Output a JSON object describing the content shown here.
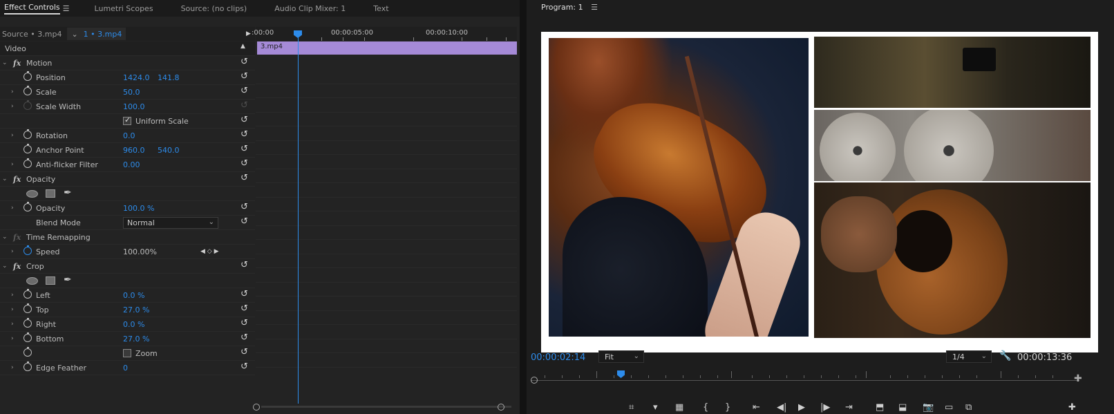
{
  "tabs": [
    "Effect Controls",
    "Lumetri Scopes",
    "Source: (no clips)",
    "Audio Clip Mixer: 1",
    "Text"
  ],
  "effect_controls": {
    "source_label": "Source • 3.mp4",
    "clip_label": "1 • 3.mp4",
    "video_label": "Video",
    "motion": {
      "label": "Motion",
      "position": {
        "label": "Position",
        "x": "1424.0",
        "y": "141.8"
      },
      "scale": {
        "label": "Scale",
        "value": "50.0"
      },
      "scale_width": {
        "label": "Scale Width",
        "value": "100.0"
      },
      "uniform_scale": {
        "label": "Uniform Scale",
        "checked": true
      },
      "rotation": {
        "label": "Rotation",
        "value": "0.0"
      },
      "anchor_point": {
        "label": "Anchor Point",
        "x": "960.0",
        "y": "540.0"
      },
      "anti_flicker": {
        "label": "Anti-flicker Filter",
        "value": "0.00"
      }
    },
    "opacity": {
      "label": "Opacity",
      "opacity": {
        "label": "Opacity",
        "value": "100.0 %"
      },
      "blend_mode": {
        "label": "Blend Mode",
        "value": "Normal"
      }
    },
    "time_remapping": {
      "label": "Time Remapping",
      "speed": {
        "label": "Speed",
        "value": "100.00%"
      }
    },
    "crop": {
      "label": "Crop",
      "left": {
        "label": "Left",
        "value": "0.0 %"
      },
      "top": {
        "label": "Top",
        "value": "27.0 %"
      },
      "right": {
        "label": "Right",
        "value": "0.0 %"
      },
      "bottom": {
        "label": "Bottom",
        "value": "27.0 %"
      },
      "zoom": {
        "label": "Zoom",
        "checked": false
      },
      "edge_feather": {
        "label": "Edge Feather",
        "value": "0"
      }
    },
    "timeline": {
      "ruler": [
        ":00:00",
        "00:00:05:00",
        "00:00:10:00"
      ],
      "clip_name": "3.mp4"
    }
  },
  "program": {
    "title": "Program: 1",
    "timecode": "00:00:02:14",
    "fit": "Fit",
    "quality": "1/4",
    "duration": "00:00:13:36"
  },
  "colors": {
    "accent": "#2d8ceb",
    "clip": "#a58ad7"
  },
  "icons": [
    "panel-menu-icon",
    "stopwatch-icon",
    "reset-icon",
    "twirl-icon",
    "ellipse-mask-icon",
    "rect-mask-icon",
    "pen-mask-icon",
    "wrench-icon",
    "play-icon"
  ]
}
